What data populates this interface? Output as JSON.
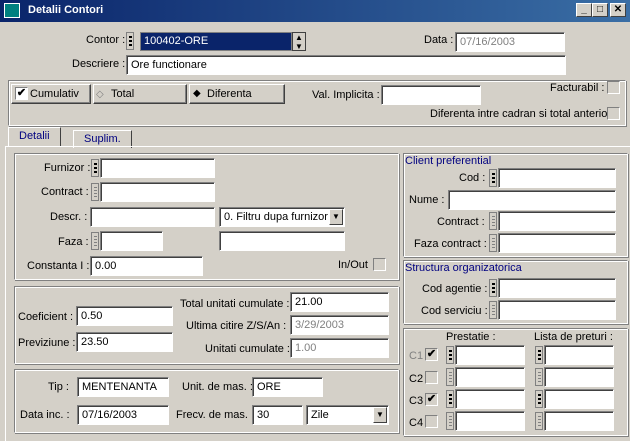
{
  "window": {
    "title": "Detalii Contori"
  },
  "header": {
    "contor_label": "Contor :",
    "contor_value": "100402-ORE",
    "data_label": "Data :",
    "data_value": "07/16/2003",
    "descriere_label": "Descriere :",
    "descriere_value": "Ore functionare"
  },
  "options": {
    "cumulativ_label": "Cumulativ",
    "total_label": "Total",
    "diferenta_label": "Diferenta",
    "val_implicita_label": "Val. Implicita :",
    "facturabil_label": "Facturabil :",
    "diferenta_cadran_label": "Diferenta intre cadran si total anterior"
  },
  "tabs": [
    {
      "label": "Detalii"
    },
    {
      "label": "Suplim."
    }
  ],
  "furnizor": {
    "furnizor_label": "Furnizor :",
    "contract_label": "Contract :",
    "descr_label": "Descr. :",
    "filtru_value": "0. Filtru dupa furnizor",
    "faza_label": "Faza :",
    "constanta_label": "Constanta I :",
    "constanta_value": "0.00",
    "inout_label": "In/Out"
  },
  "client": {
    "section_title": "Client preferential",
    "cod_label": "Cod :",
    "nume_label": "Nume :",
    "contract_label": "Contract :",
    "faza_contract_label": "Faza contract :"
  },
  "structura": {
    "section_title": "Structura organizatorica",
    "cod_agentie_label": "Cod agentie :",
    "cod_serviciu_label": "Cod serviciu :"
  },
  "calcul": {
    "coeficient_label": "Coeficient :",
    "coeficient_value": "0.50",
    "previziune_label": "Previziune :",
    "previziune_value": "23.50",
    "total_label": "Total unitati cumulate :",
    "total_value": "21.00",
    "ultima_label": "Ultima citire Z/S/An :",
    "ultima_value": "3/29/2003",
    "unitati_label": "Unitati cumulate :",
    "unitati_value": "1.00"
  },
  "tip": {
    "tip_label": "Tip :",
    "tip_value": "MENTENANTA",
    "unit_label": "Unit. de mas. :",
    "unit_value": "ORE",
    "data_inc_label": "Data inc. :",
    "data_inc_value": "07/16/2003",
    "frecv_label": "Frecv. de mas. :",
    "frecv_value": "30",
    "zile_value": "Zile"
  },
  "prestatie": {
    "prestatie_header": "Prestatie :",
    "lista_header": "Lista de preturi :",
    "rows": [
      {
        "label": "C1"
      },
      {
        "label": "C2"
      },
      {
        "label": "C3"
      },
      {
        "label": "C4"
      }
    ]
  }
}
